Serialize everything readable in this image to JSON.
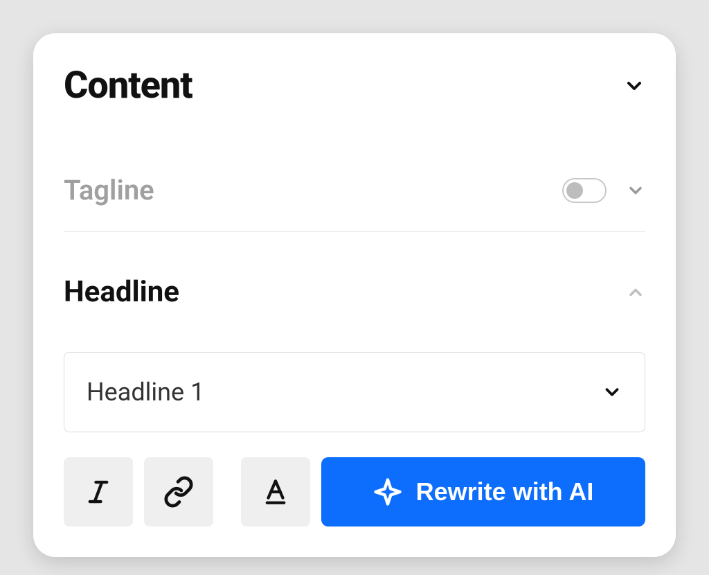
{
  "panel": {
    "title": "Content"
  },
  "tagline": {
    "label": "Tagline",
    "enabled": false
  },
  "headline": {
    "label": "Headline",
    "selectValue": "Headline 1"
  },
  "toolbar": {
    "aiButtonLabel": "Rewrite with AI"
  }
}
